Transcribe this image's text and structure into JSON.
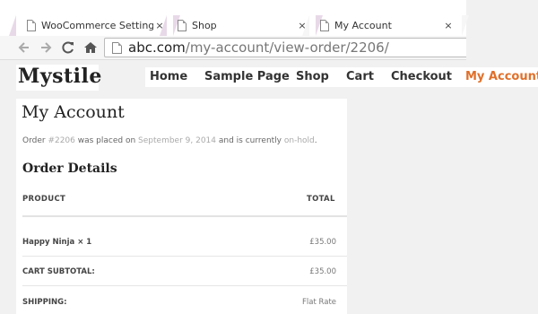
{
  "browser": {
    "tabs": [
      {
        "label": "WooCommerce Settings ‹",
        "close": "×"
      },
      {
        "label": "Shop",
        "close": "×"
      },
      {
        "label": "My Account",
        "close": "×"
      }
    ],
    "url_host": "abc.com",
    "url_path": "/my-account/view-order/2206/",
    "back_icon": "arrow-left-icon",
    "forward_icon": "arrow-right-icon",
    "reload_icon": "reload-icon",
    "home_icon": "home-icon"
  },
  "site": {
    "logo": "Mystile",
    "nav": [
      "Home",
      "Sample Page",
      "Shop",
      "Cart",
      "Checkout",
      "My Account"
    ],
    "active_nav": "My Account",
    "accent_color": "#e0702a"
  },
  "page": {
    "title": "My Account",
    "order_text_1": "Order ",
    "order_number": "#2206",
    "order_text_2": " was placed on ",
    "order_date": "September 9, 2014",
    "order_text_3": " and is currently ",
    "order_status": "on-hold",
    "order_text_4": ".",
    "section_title": "Order Details",
    "table": {
      "headers": {
        "product": "PRODUCT",
        "total": "TOTAL"
      },
      "rows": [
        {
          "label": "Happy Ninja × 1",
          "value": "£35.00"
        },
        {
          "label": "CART SUBTOTAL:",
          "value": "£35.00"
        },
        {
          "label": "SHIPPING:",
          "value": "Flat Rate"
        }
      ]
    }
  }
}
